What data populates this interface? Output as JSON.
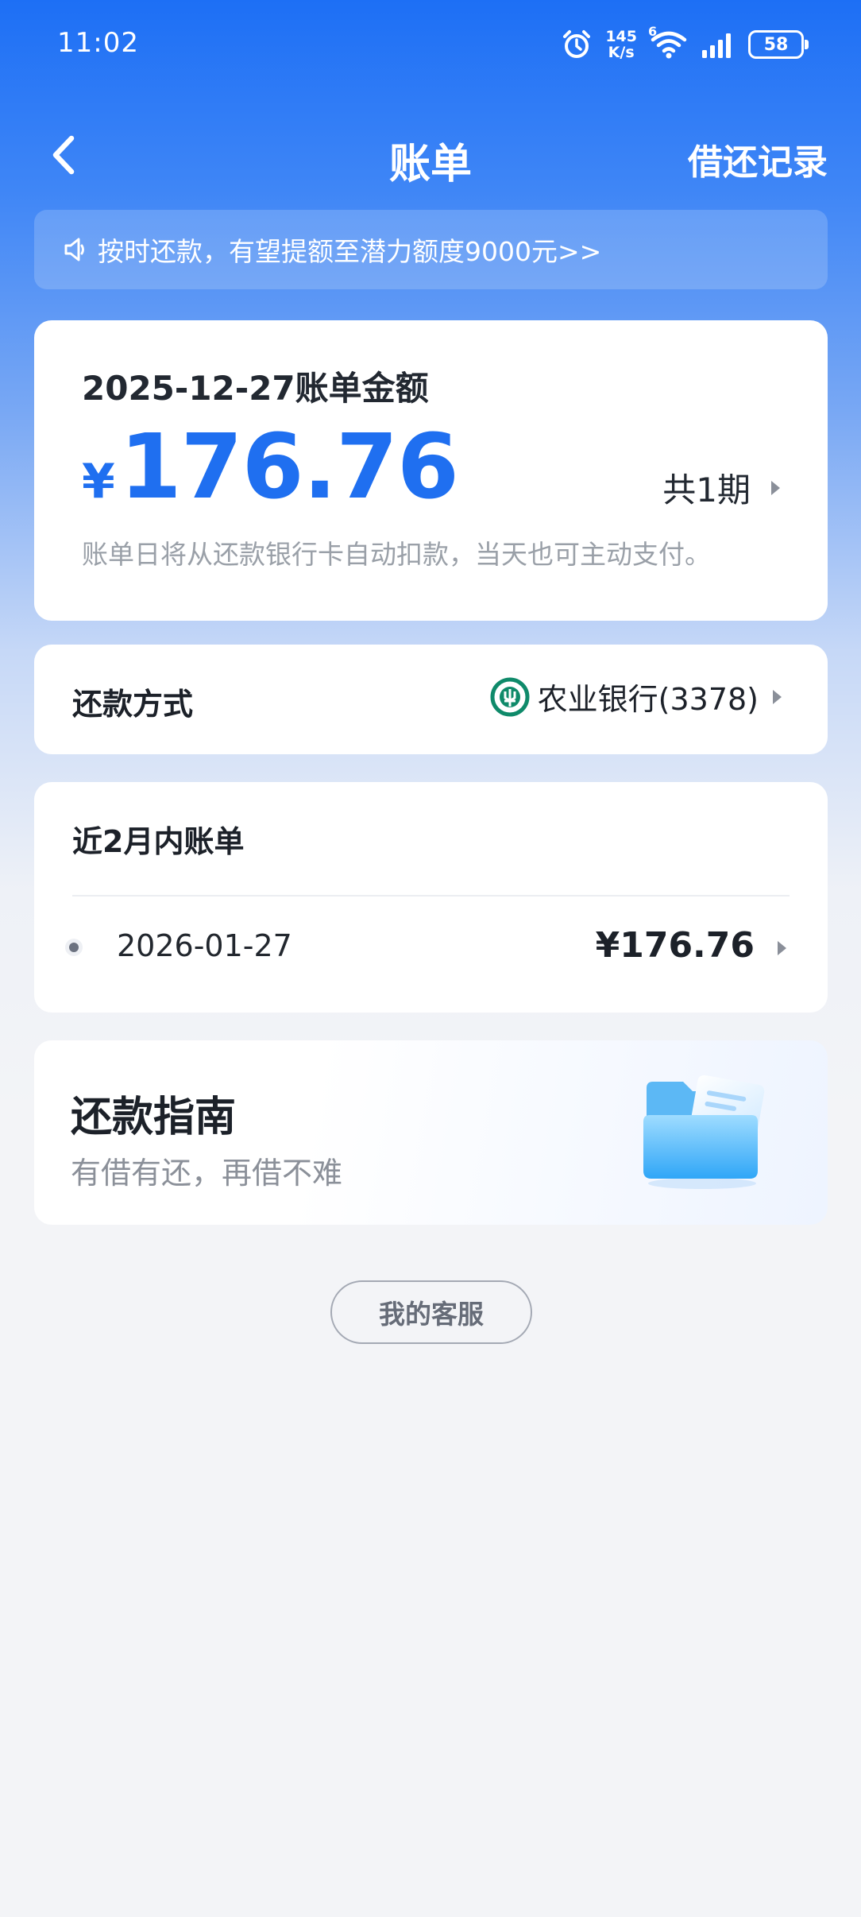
{
  "status_bar": {
    "time": "11:02",
    "net_speed_value": "145",
    "net_speed_unit": "K/s",
    "wifi_badge": "6",
    "battery": "58"
  },
  "nav": {
    "title": "账单",
    "right_action": "借还记录"
  },
  "notice": {
    "text": "按时还款，有望提额至潜力额度9000元>>"
  },
  "bill": {
    "date_label": "2025-12-27账单金额",
    "currency": "¥",
    "amount": "176.76",
    "periods": "共1期",
    "hint": "账单日将从还款银行卡自动扣款，当天也可主动支付。"
  },
  "payment": {
    "label": "还款方式",
    "bank": "农业银行(3378)"
  },
  "recent": {
    "title": "近2月内账单",
    "items": [
      {
        "date": "2026-01-27",
        "amount": "¥176.76"
      }
    ]
  },
  "guide": {
    "title": "还款指南",
    "subtitle": "有借有还，再借不难"
  },
  "service": {
    "label": "我的客服"
  },
  "colors": {
    "accent_blue": "#1f6ff0",
    "header_blue": "#1d6ff5",
    "bank_green": "#0f8a6a"
  }
}
